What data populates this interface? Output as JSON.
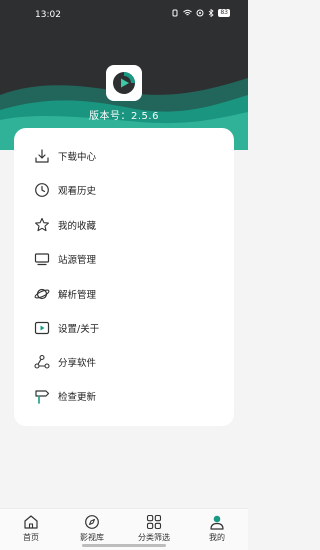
{
  "status_bar": {
    "time": "13:02",
    "battery": "83"
  },
  "app": {
    "version_text": "版本号：2.5.6"
  },
  "colors": {
    "header_bg": "#2e2f31",
    "accent": "#1a9a84",
    "icon_stroke": "#333333"
  },
  "menu": {
    "items": [
      {
        "label": "下载中心",
        "icon": "download-icon"
      },
      {
        "label": "观看历史",
        "icon": "clock-icon"
      },
      {
        "label": "我的收藏",
        "icon": "star-icon"
      },
      {
        "label": "站源管理",
        "icon": "monitor-icon"
      },
      {
        "label": "解析管理",
        "icon": "planet-icon"
      },
      {
        "label": "设置/关于",
        "icon": "video-play-icon"
      },
      {
        "label": "分享软件",
        "icon": "share-icon"
      },
      {
        "label": "检查更新",
        "icon": "signpost-icon"
      }
    ]
  },
  "tabbar": {
    "tabs": [
      {
        "label": "首页",
        "icon": "home-icon"
      },
      {
        "label": "影视库",
        "icon": "compass-icon"
      },
      {
        "label": "分类筛选",
        "icon": "grid-icon"
      },
      {
        "label": "我的",
        "icon": "user-icon",
        "active": true
      }
    ]
  }
}
